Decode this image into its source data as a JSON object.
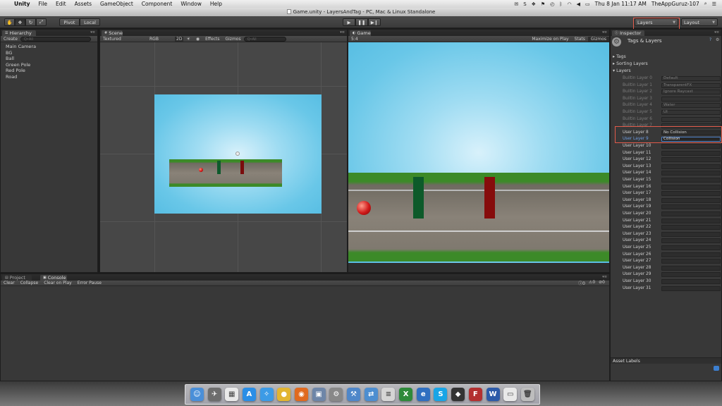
{
  "menubar": {
    "apple": "",
    "app_name": "Unity",
    "items": [
      "File",
      "Edit",
      "Assets",
      "GameObject",
      "Component",
      "Window",
      "Help"
    ],
    "datetime": "Thu 8 Jan  11:17 AM",
    "user": "TheAppGuruz-107"
  },
  "titlebar": {
    "title": "Game.unity - LayersAndTag - PC, Mac & Linux Standalone"
  },
  "toolbar": {
    "pivot": "Pivot",
    "local": "Local",
    "layers_dropdown": "Layers",
    "layout_dropdown": "Layout"
  },
  "hierarchy": {
    "tab": "Hierarchy",
    "create": "Create",
    "search_placeholder": "Q•All",
    "items": [
      "Main Camera",
      "BG",
      "Ball",
      "Green Pole",
      "Red Pole",
      "Road"
    ]
  },
  "scene": {
    "tab": "Scene",
    "shading": "Textured",
    "render": "RGB",
    "mode_2d": "2D",
    "effects": "Effects",
    "gizmos": "Gizmos",
    "search_placeholder": "Q•All"
  },
  "game": {
    "tab": "Game",
    "aspect": "5:4",
    "maximize": "Maximize on Play",
    "stats": "Stats",
    "gizmos": "Gizmos"
  },
  "inspector": {
    "tab": "Inspector",
    "title": "Tags & Layers",
    "sections": {
      "tags": "Tags",
      "sorting": "Sorting Layers",
      "layers": "Layers"
    },
    "layers": [
      {
        "label": "Builtin Layer 0",
        "value": "Default",
        "dim": true
      },
      {
        "label": "Builtin Layer 1",
        "value": "TransparentFX",
        "dim": true
      },
      {
        "label": "Builtin Layer 2",
        "value": "Ignore Raycast",
        "dim": true
      },
      {
        "label": "Builtin Layer 3",
        "value": "",
        "dim": true
      },
      {
        "label": "Builtin Layer 4",
        "value": "Water",
        "dim": true
      },
      {
        "label": "Builtin Layer 5",
        "value": "UI",
        "dim": true
      },
      {
        "label": "Builtin Layer 6",
        "value": "",
        "dim": true
      },
      {
        "label": "Builtin Layer 7",
        "value": "",
        "dim": true
      },
      {
        "label": "User Layer 8",
        "value": "No Collision",
        "dim": false
      },
      {
        "label": "User Layer 9",
        "value": "Collision",
        "dim": false,
        "focus": true
      },
      {
        "label": "User Layer 10",
        "value": ""
      },
      {
        "label": "User Layer 11",
        "value": ""
      },
      {
        "label": "User Layer 12",
        "value": ""
      },
      {
        "label": "User Layer 13",
        "value": ""
      },
      {
        "label": "User Layer 14",
        "value": ""
      },
      {
        "label": "User Layer 15",
        "value": ""
      },
      {
        "label": "User Layer 16",
        "value": ""
      },
      {
        "label": "User Layer 17",
        "value": ""
      },
      {
        "label": "User Layer 18",
        "value": ""
      },
      {
        "label": "User Layer 19",
        "value": ""
      },
      {
        "label": "User Layer 20",
        "value": ""
      },
      {
        "label": "User Layer 21",
        "value": ""
      },
      {
        "label": "User Layer 22",
        "value": ""
      },
      {
        "label": "User Layer 23",
        "value": ""
      },
      {
        "label": "User Layer 24",
        "value": ""
      },
      {
        "label": "User Layer 25",
        "value": ""
      },
      {
        "label": "User Layer 26",
        "value": ""
      },
      {
        "label": "User Layer 27",
        "value": ""
      },
      {
        "label": "User Layer 28",
        "value": ""
      },
      {
        "label": "User Layer 29",
        "value": ""
      },
      {
        "label": "User Layer 30",
        "value": ""
      },
      {
        "label": "User Layer 31",
        "value": ""
      }
    ],
    "asset_labels": "Asset Labels"
  },
  "console": {
    "tab_project": "Project",
    "tab_console": "Console",
    "buttons": [
      "Clear",
      "Collapse",
      "Clear on Play",
      "Error Pause"
    ],
    "counts": [
      "0",
      "0",
      "0"
    ]
  },
  "dock": {
    "apps": [
      {
        "name": "finder",
        "color": "#4a8fd8",
        "glyph": "☺"
      },
      {
        "name": "launchpad",
        "color": "#6d6d6d",
        "glyph": "✈"
      },
      {
        "name": "calendar",
        "color": "#e9e9e9",
        "glyph": "▦"
      },
      {
        "name": "app-store",
        "color": "#2a8ee6",
        "glyph": "A"
      },
      {
        "name": "safari",
        "color": "#3c9be6",
        "glyph": "✧"
      },
      {
        "name": "chrome",
        "color": "#e2b531",
        "glyph": "●"
      },
      {
        "name": "firefox",
        "color": "#e06a1f",
        "glyph": "◉"
      },
      {
        "name": "preview",
        "color": "#6e86a8",
        "glyph": "▣"
      },
      {
        "name": "system-preferences",
        "color": "#888888",
        "glyph": "⚙"
      },
      {
        "name": "xcode",
        "color": "#4f87c9",
        "glyph": "⚒"
      },
      {
        "name": "network",
        "color": "#4d8ed0",
        "glyph": "⇄"
      },
      {
        "name": "notes",
        "color": "#d5d5d5",
        "glyph": "≡"
      },
      {
        "name": "excel",
        "color": "#2e8a3a",
        "glyph": "X"
      },
      {
        "name": "ie",
        "color": "#2f6fc0",
        "glyph": "e"
      },
      {
        "name": "skype",
        "color": "#19a5e6",
        "glyph": "S"
      },
      {
        "name": "unity",
        "color": "#333333",
        "glyph": "◆"
      },
      {
        "name": "filezilla",
        "color": "#b33030",
        "glyph": "F"
      },
      {
        "name": "word",
        "color": "#2c5aa8",
        "glyph": "W"
      },
      {
        "name": "documents",
        "color": "#e8e8e8",
        "glyph": "▭"
      },
      {
        "name": "trash",
        "color": "#bdbdbd",
        "glyph": "🗑"
      }
    ]
  }
}
